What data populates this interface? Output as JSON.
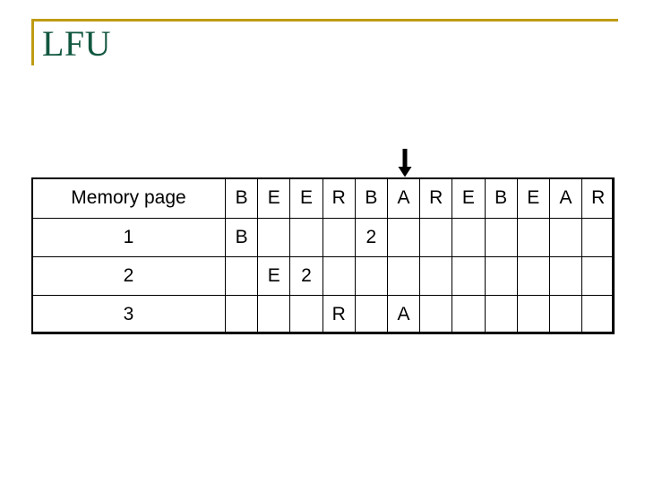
{
  "slide": {
    "title": "LFU",
    "accent_color": "#bf9b13",
    "title_color": "#115740"
  },
  "pointer": {
    "icon": "down-arrow-icon",
    "target_column_index": 5,
    "target_column_label": "A"
  },
  "table": {
    "label_header": "Memory page",
    "reference_string": [
      "B",
      "E",
      "E",
      "R",
      "B",
      "A",
      "R",
      "E",
      "B",
      "E",
      "A",
      "R"
    ],
    "page_color": "#cc88dd",
    "count_color": "#a51c30",
    "rows": [
      {
        "label": "1",
        "cells": [
          "B",
          "",
          "",
          "",
          "2",
          "",
          "",
          "",
          "",
          "",
          "",
          ""
        ],
        "kinds": [
          "page",
          "",
          "",
          "",
          "count",
          "",
          "",
          "",
          "",
          "",
          "",
          ""
        ]
      },
      {
        "label": "2",
        "cells": [
          "",
          "E",
          "2",
          "",
          "",
          "",
          "",
          "",
          "",
          "",
          "",
          ""
        ],
        "kinds": [
          "",
          "page",
          "count",
          "",
          "",
          "",
          "",
          "",
          "",
          "",
          "",
          ""
        ]
      },
      {
        "label": "3",
        "cells": [
          "",
          "",
          "",
          "R",
          "",
          "A",
          "",
          "",
          "",
          "",
          "",
          ""
        ],
        "kinds": [
          "",
          "",
          "",
          "page",
          "",
          "page",
          "",
          "",
          "",
          "",
          "",
          ""
        ]
      }
    ]
  }
}
